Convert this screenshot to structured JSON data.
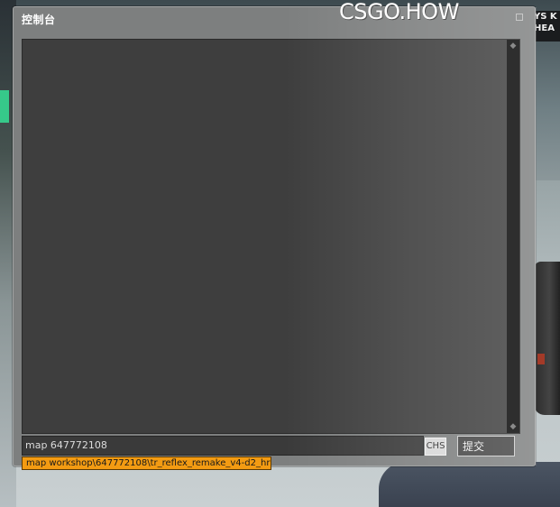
{
  "background": {
    "sign_lines": [
      "YS K",
      "HEA"
    ]
  },
  "console": {
    "title": "控制台",
    "watermark": "CSGO.HOW",
    "input": {
      "value": "map 647772108",
      "placeholder": ""
    },
    "ime_indicator": "CHS",
    "submit_label": "提交",
    "suggestion": "map workshop\\647772108\\tr_reflex_remake_v4-d2_hr"
  },
  "icons": {
    "scroll_up": "scroll-up-icon",
    "scroll_down": "scroll-down-icon",
    "close": "close-icon"
  },
  "colors": {
    "suggestion_bg": "#f39b12",
    "window_bg": "#7d7f7f",
    "output_bg": "#3e3e3e"
  }
}
